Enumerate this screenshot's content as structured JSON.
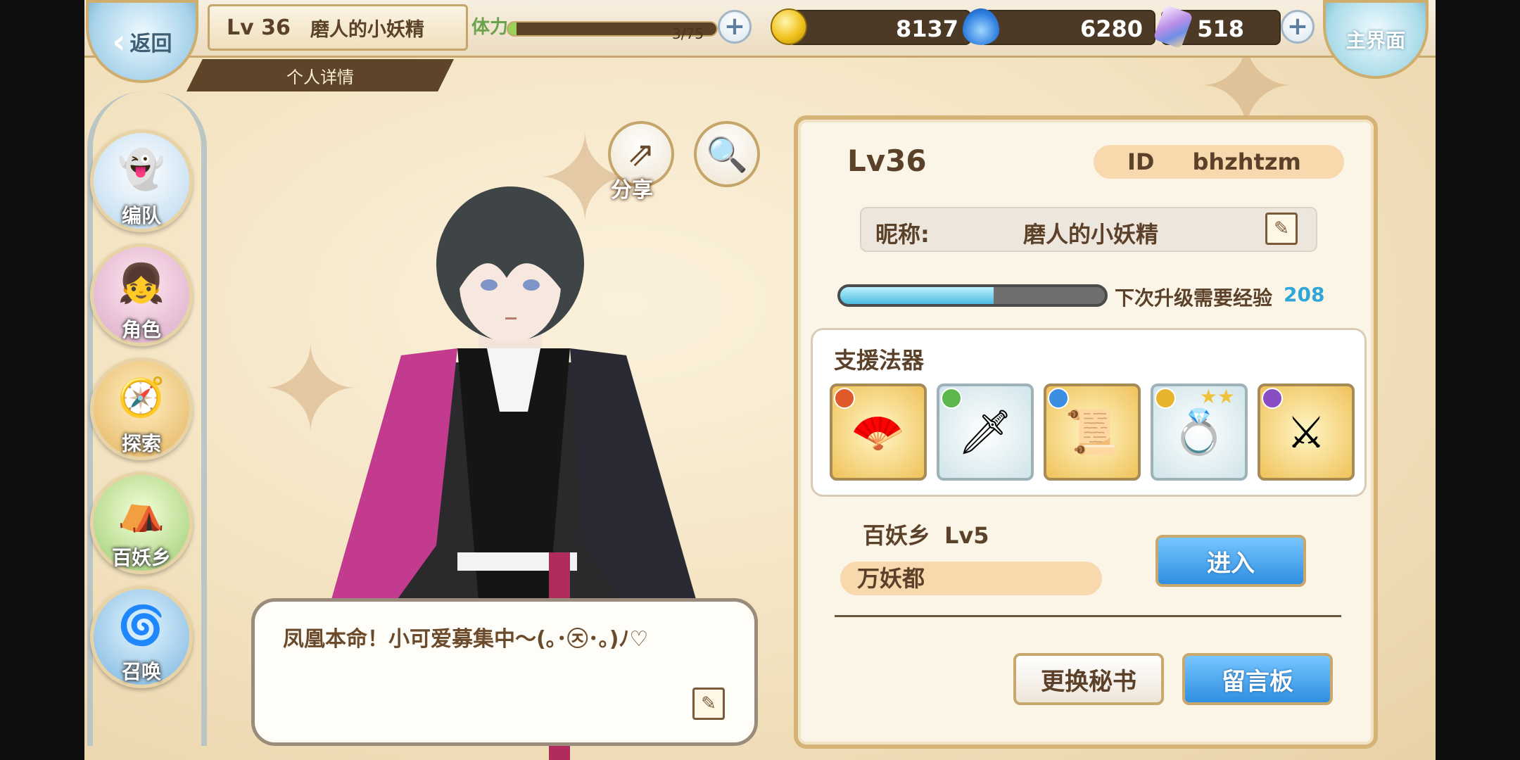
{
  "top_bar": {
    "back_label": "返回",
    "player_level": "Lv 36",
    "player_name": "磨人的小妖精",
    "subtab": "个人详情",
    "stamina_label": "体力",
    "stamina_value": "3/75",
    "gold": "8137",
    "spirit": "6280",
    "crystal": "518",
    "home_label": "主界面"
  },
  "nav": [
    {
      "label": "编队",
      "icon": "team-icon"
    },
    {
      "label": "角色",
      "icon": "character-icon"
    },
    {
      "label": "探索",
      "icon": "explore-icon"
    },
    {
      "label": "百妖乡",
      "icon": "village-icon"
    },
    {
      "label": "召唤",
      "icon": "summon-icon"
    }
  ],
  "actions": {
    "share_label": "分享"
  },
  "bubble": {
    "text": "凤凰本命！小可爱募集中～(｡･㉨･｡)ﾉ♡"
  },
  "profile": {
    "level": "Lv36",
    "id_label": "ID",
    "id_value": "bhzhtzm",
    "nick_label": "昵称:",
    "nick_value": "磨人的小妖精",
    "exp_label": "下次升级需要经验",
    "exp_value": "208",
    "exp_progress": 0.58,
    "support_title": "支援法器",
    "support_items": [
      {
        "icon": "fan-icon",
        "frame": "gold"
      },
      {
        "icon": "green-blade-icon",
        "frame": "silver"
      },
      {
        "icon": "scroll-icon",
        "frame": "gold"
      },
      {
        "icon": "ring-icon",
        "frame": "silver",
        "stars": "★★"
      },
      {
        "icon": "sword-icon",
        "frame": "gold"
      }
    ],
    "village_label": "百妖乡",
    "village_level": "Lv5",
    "village_name": "万妖都",
    "enter_label": "进入",
    "change_secretary_label": "更换秘书",
    "message_board_label": "留言板"
  },
  "colors": {
    "accent_blue": "#2f8fe0",
    "brown_text": "#5b4129",
    "exp_value": "#2ea6d8"
  }
}
